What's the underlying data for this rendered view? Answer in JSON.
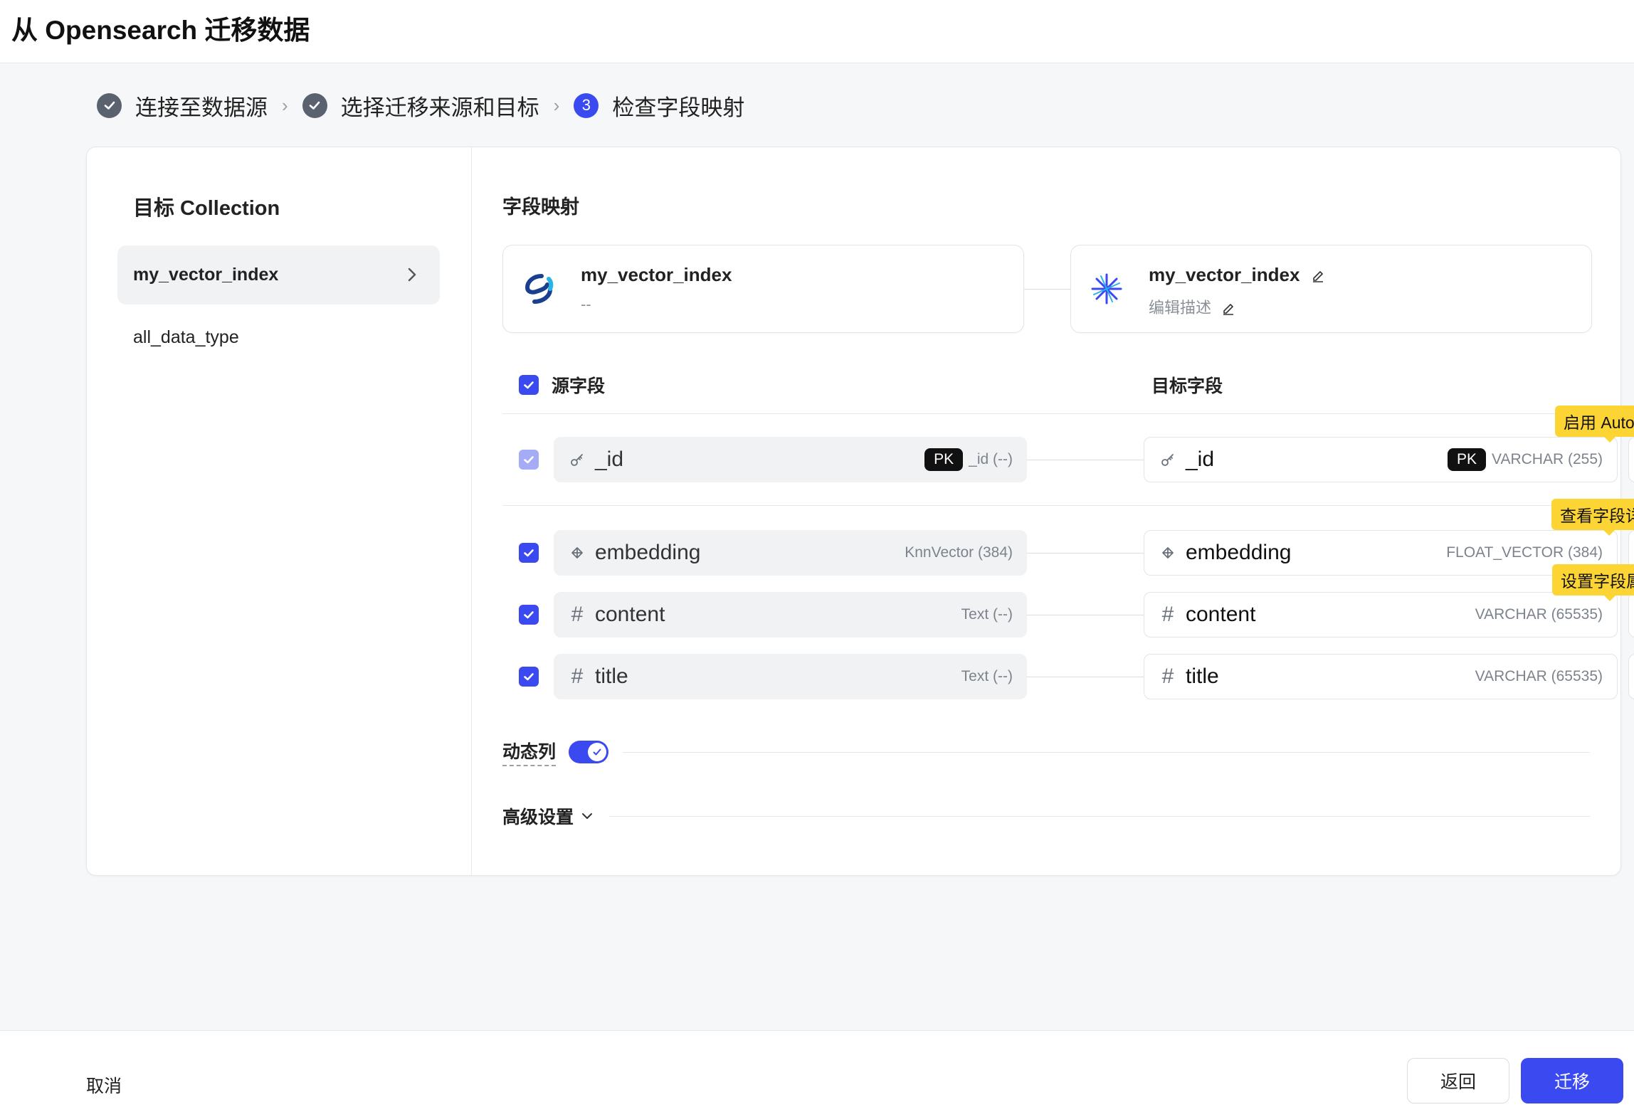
{
  "header": {
    "title": "从 Opensearch 迁移数据"
  },
  "stepper": {
    "steps": [
      {
        "label": "连接至数据源",
        "status": "done"
      },
      {
        "label": "选择迁移来源和目标",
        "status": "done"
      },
      {
        "label": "检查字段映射",
        "status": "active",
        "number": "3"
      }
    ]
  },
  "left": {
    "heading": "目标 Collection",
    "collections": [
      "my_vector_index",
      "all_data_type"
    ]
  },
  "mapping": {
    "title": "字段映射",
    "source": {
      "name": "my_vector_index",
      "desc": "--"
    },
    "target": {
      "name": "my_vector_index",
      "desc": "编辑描述"
    },
    "source_col": "源字段",
    "target_col": "目标字段",
    "pk_label": "PK",
    "rows": [
      {
        "src_name": "_id",
        "src_type": "_id (--)",
        "dst_name": "_id",
        "dst_type": "VARCHAR (255)"
      },
      {
        "src_name": "embedding",
        "src_type": "KnnVector (384)",
        "dst_name": "embedding",
        "dst_type": "FLOAT_VECTOR (384)"
      },
      {
        "src_name": "content",
        "src_type": "Text (--)",
        "dst_name": "content",
        "dst_type": "VARCHAR (65535)"
      },
      {
        "src_name": "title",
        "src_type": "Text (--)",
        "dst_name": "title",
        "dst_type": "VARCHAR (65535)"
      }
    ],
    "tooltips": {
      "auto_id": "启用 Auto ID",
      "view_detail": "查看字段详情",
      "set_props": "设置字段属性"
    },
    "dynamic_label": "动态列",
    "dynamic_enabled": true,
    "advanced_label": "高级设置"
  },
  "footer": {
    "cancel": "取消",
    "back": "返回",
    "migrate": "迁移"
  },
  "colors": {
    "accent": "#3b49f0",
    "tooltip": "#fcd535"
  }
}
